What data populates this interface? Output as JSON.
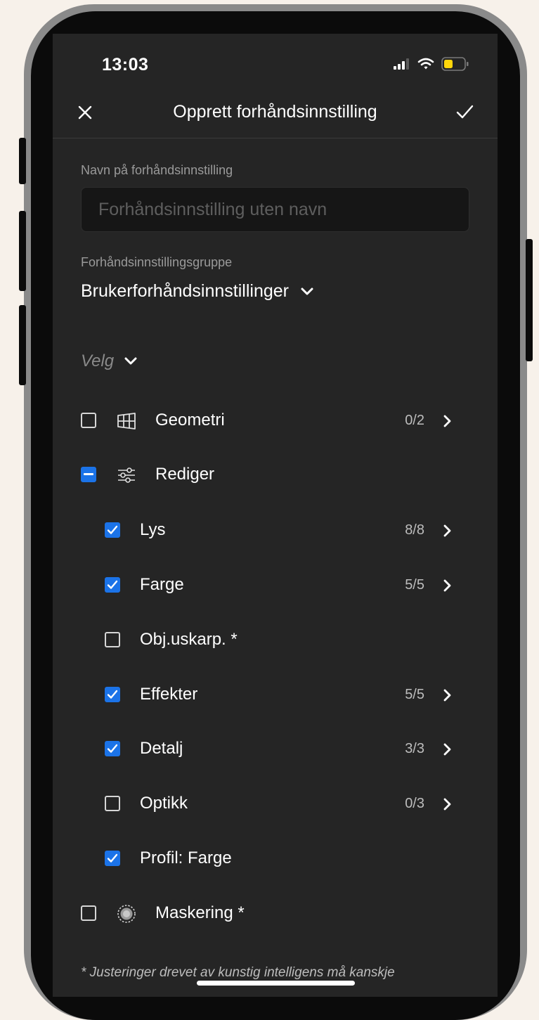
{
  "status_bar": {
    "time": "13:03",
    "icons": [
      "signal-icon",
      "wifi-icon",
      "battery-icon"
    ],
    "battery_color": "#ffd60a"
  },
  "nav": {
    "title": "Opprett forhåndsinnstilling",
    "close_icon": "close-icon",
    "confirm_icon": "checkmark-icon"
  },
  "form": {
    "name_label": "Navn på forhåndsinnstilling",
    "name_placeholder": "Forhåndsinnstilling uten navn",
    "name_value": "",
    "group_label": "Forhåndsinnstillingsgruppe",
    "group_value": "Brukerforhåndsinnstillinger",
    "select_label": "Velg"
  },
  "settings": [
    {
      "id": "geometri",
      "label": "Geometri",
      "state": "unchecked",
      "icon": "geometry-grid-icon",
      "count": "0/2",
      "chevron": true,
      "level": 0
    },
    {
      "id": "rediger",
      "label": "Rediger",
      "state": "partial",
      "icon": "sliders-icon",
      "count": "",
      "chevron": false,
      "level": 0
    },
    {
      "id": "lys",
      "label": "Lys",
      "state": "checked",
      "icon": "",
      "count": "8/8",
      "chevron": true,
      "level": 1
    },
    {
      "id": "farge",
      "label": "Farge",
      "state": "checked",
      "icon": "",
      "count": "5/5",
      "chevron": true,
      "level": 1
    },
    {
      "id": "obj-uskarp",
      "label": "Obj.uskarp. *",
      "state": "unchecked",
      "icon": "",
      "count": "",
      "chevron": false,
      "level": 1
    },
    {
      "id": "effekter",
      "label": "Effekter",
      "state": "checked",
      "icon": "",
      "count": "5/5",
      "chevron": true,
      "level": 1
    },
    {
      "id": "detalj",
      "label": "Detalj",
      "state": "checked",
      "icon": "",
      "count": "3/3",
      "chevron": true,
      "level": 1
    },
    {
      "id": "optikk",
      "label": "Optikk",
      "state": "unchecked",
      "icon": "",
      "count": "0/3",
      "chevron": true,
      "level": 1
    },
    {
      "id": "profil-farge",
      "label": "Profil: Farge",
      "state": "checked",
      "icon": "",
      "count": "",
      "chevron": false,
      "level": 1
    },
    {
      "id": "maskering",
      "label": "Maskering *",
      "state": "unchecked",
      "icon": "masking-icon",
      "count": "",
      "chevron": false,
      "level": 0
    }
  ],
  "footnote": "* Justeringer drevet av kunstig intelligens må kanskje",
  "colors": {
    "accent": "#1b73e8",
    "background": "#252525",
    "page_background": "#f7f1ea"
  }
}
